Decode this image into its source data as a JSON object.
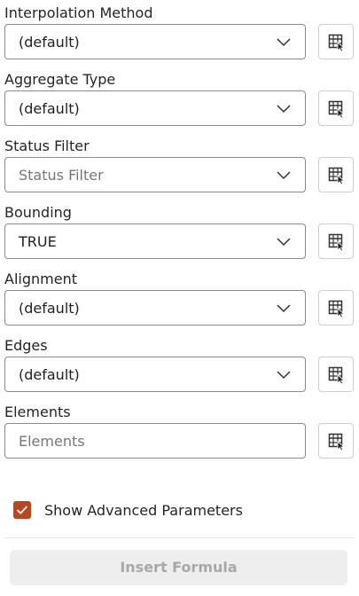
{
  "fields": [
    {
      "label": "Interpolation Method",
      "value": "(default)",
      "placeholder": false
    },
    {
      "label": "Aggregate Type",
      "value": "(default)",
      "placeholder": false
    },
    {
      "label": "Status Filter",
      "value": "Status Filter",
      "placeholder": true
    },
    {
      "label": "Bounding",
      "value": "TRUE",
      "placeholder": false
    },
    {
      "label": "Alignment",
      "value": "(default)",
      "placeholder": false
    },
    {
      "label": "Edges",
      "value": "(default)",
      "placeholder": false
    },
    {
      "label": "Elements",
      "value": "Elements",
      "placeholder": true
    }
  ],
  "advanced": {
    "label": "Show Advanced Parameters",
    "checked": true
  },
  "insert_button": {
    "label": "Insert Formula",
    "enabled": false
  },
  "icons": {
    "dropdown": "chevron-down-icon",
    "cell_reference": "table-select-icon",
    "checkbox": "checkmark-icon"
  },
  "colors": {
    "accent": "#b9461f",
    "disabled_button_bg": "#eeeeee",
    "disabled_button_text": "#a8a8a8"
  }
}
